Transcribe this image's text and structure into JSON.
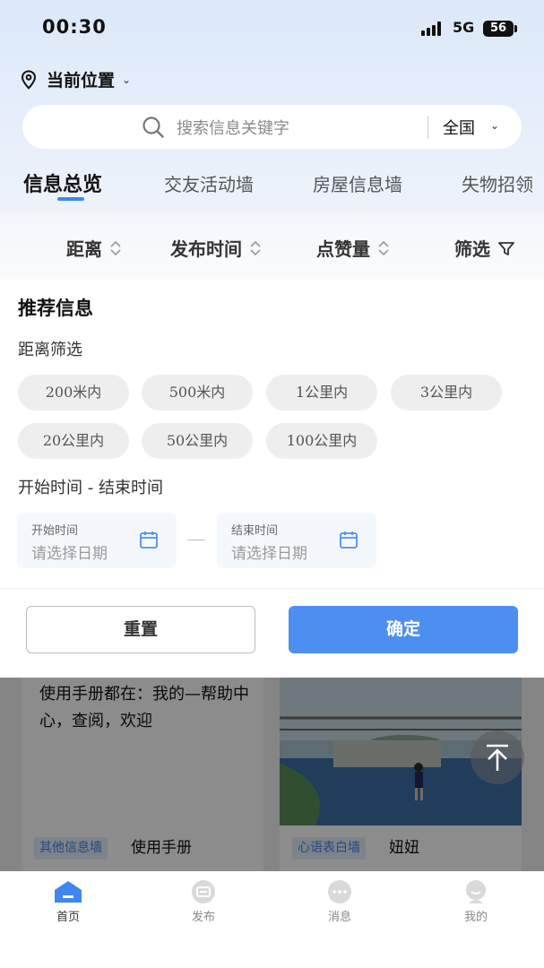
{
  "status_bar": {
    "time": "00:30",
    "network": "5G",
    "battery": "56"
  },
  "location": {
    "label": "当前位置",
    "icon": "location-pin-icon"
  },
  "search": {
    "placeholder": "搜索信息关键字",
    "scope": "全国",
    "icon": "search-icon"
  },
  "tabs": [
    {
      "label": "信息总览",
      "active": true
    },
    {
      "label": "交友活动墙",
      "active": false
    },
    {
      "label": "房屋信息墙",
      "active": false
    },
    {
      "label": "失物招领",
      "active": false
    }
  ],
  "sort_bar": {
    "distance": "距离",
    "publish_time": "发布时间",
    "likes": "点赞量",
    "filter": "筛选"
  },
  "filter_panel": {
    "title": "推荐信息",
    "distance_section": "距离筛选",
    "distance_options": [
      "200米内",
      "500米内",
      "1公里内",
      "3公里内",
      "20公里内",
      "50公里内",
      "100公里内"
    ],
    "time_section": "开始时间 - 结束时间",
    "start_label": "开始时间",
    "start_placeholder": "请选择日期",
    "end_label": "结束时间",
    "end_placeholder": "请选择日期",
    "reset_label": "重置",
    "confirm_label": "确定"
  },
  "feed": {
    "cards": [
      {
        "text": "使用手册都在：我的—帮助中心，查阅，欢迎",
        "tag": "其他信息墙",
        "title": "使用手册"
      },
      {
        "tag": "心语表白墙",
        "title": "妞妞"
      }
    ]
  },
  "bottom_nav": [
    {
      "label": "首页",
      "icon": "home-icon",
      "active": true
    },
    {
      "label": "发布",
      "icon": "publish-icon",
      "active": false
    },
    {
      "label": "消息",
      "icon": "message-icon",
      "active": false
    },
    {
      "label": "我的",
      "icon": "profile-icon",
      "active": false
    }
  ],
  "colors": {
    "accent": "#4d8ff0",
    "tab_indicator": "#3f86ee",
    "chip_bg": "#eeeeee"
  }
}
